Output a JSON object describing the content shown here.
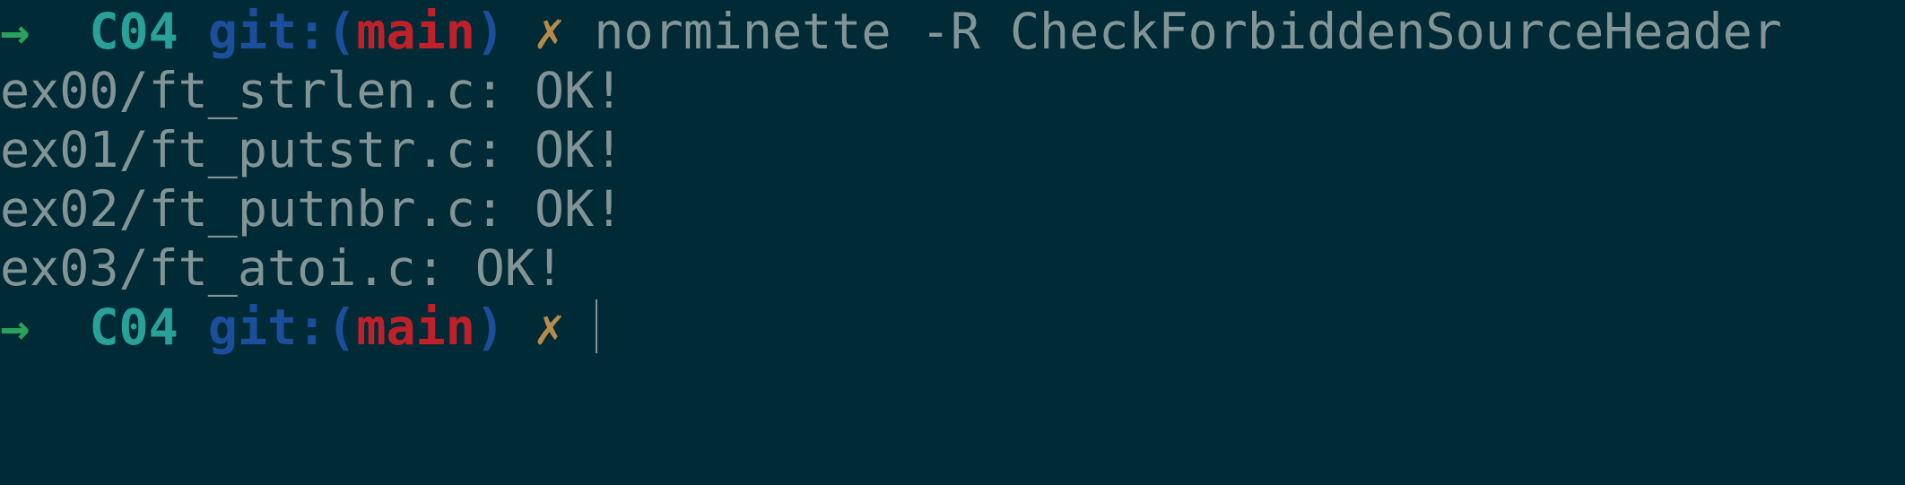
{
  "prompt": {
    "arrow": "→",
    "dir": "C04",
    "git_prefix": "git:(",
    "branch": "main",
    "git_suffix": ")",
    "dirty_mark": "✗"
  },
  "command": "norminette -R CheckForbiddenSourceHeader",
  "output_lines": [
    "ex00/ft_strlen.c: OK!",
    "ex01/ft_putstr.c: OK!",
    "ex02/ft_putnbr.c: OK!",
    "ex03/ft_atoi.c: OK!"
  ],
  "colors": {
    "background": "#002b36",
    "text": "#839496",
    "arrow": "#2aa15a",
    "dir": "#2aa198",
    "git_label": "#1b4e9b",
    "branch": "#c0202a",
    "dirty_mark": "#b58a4a"
  }
}
